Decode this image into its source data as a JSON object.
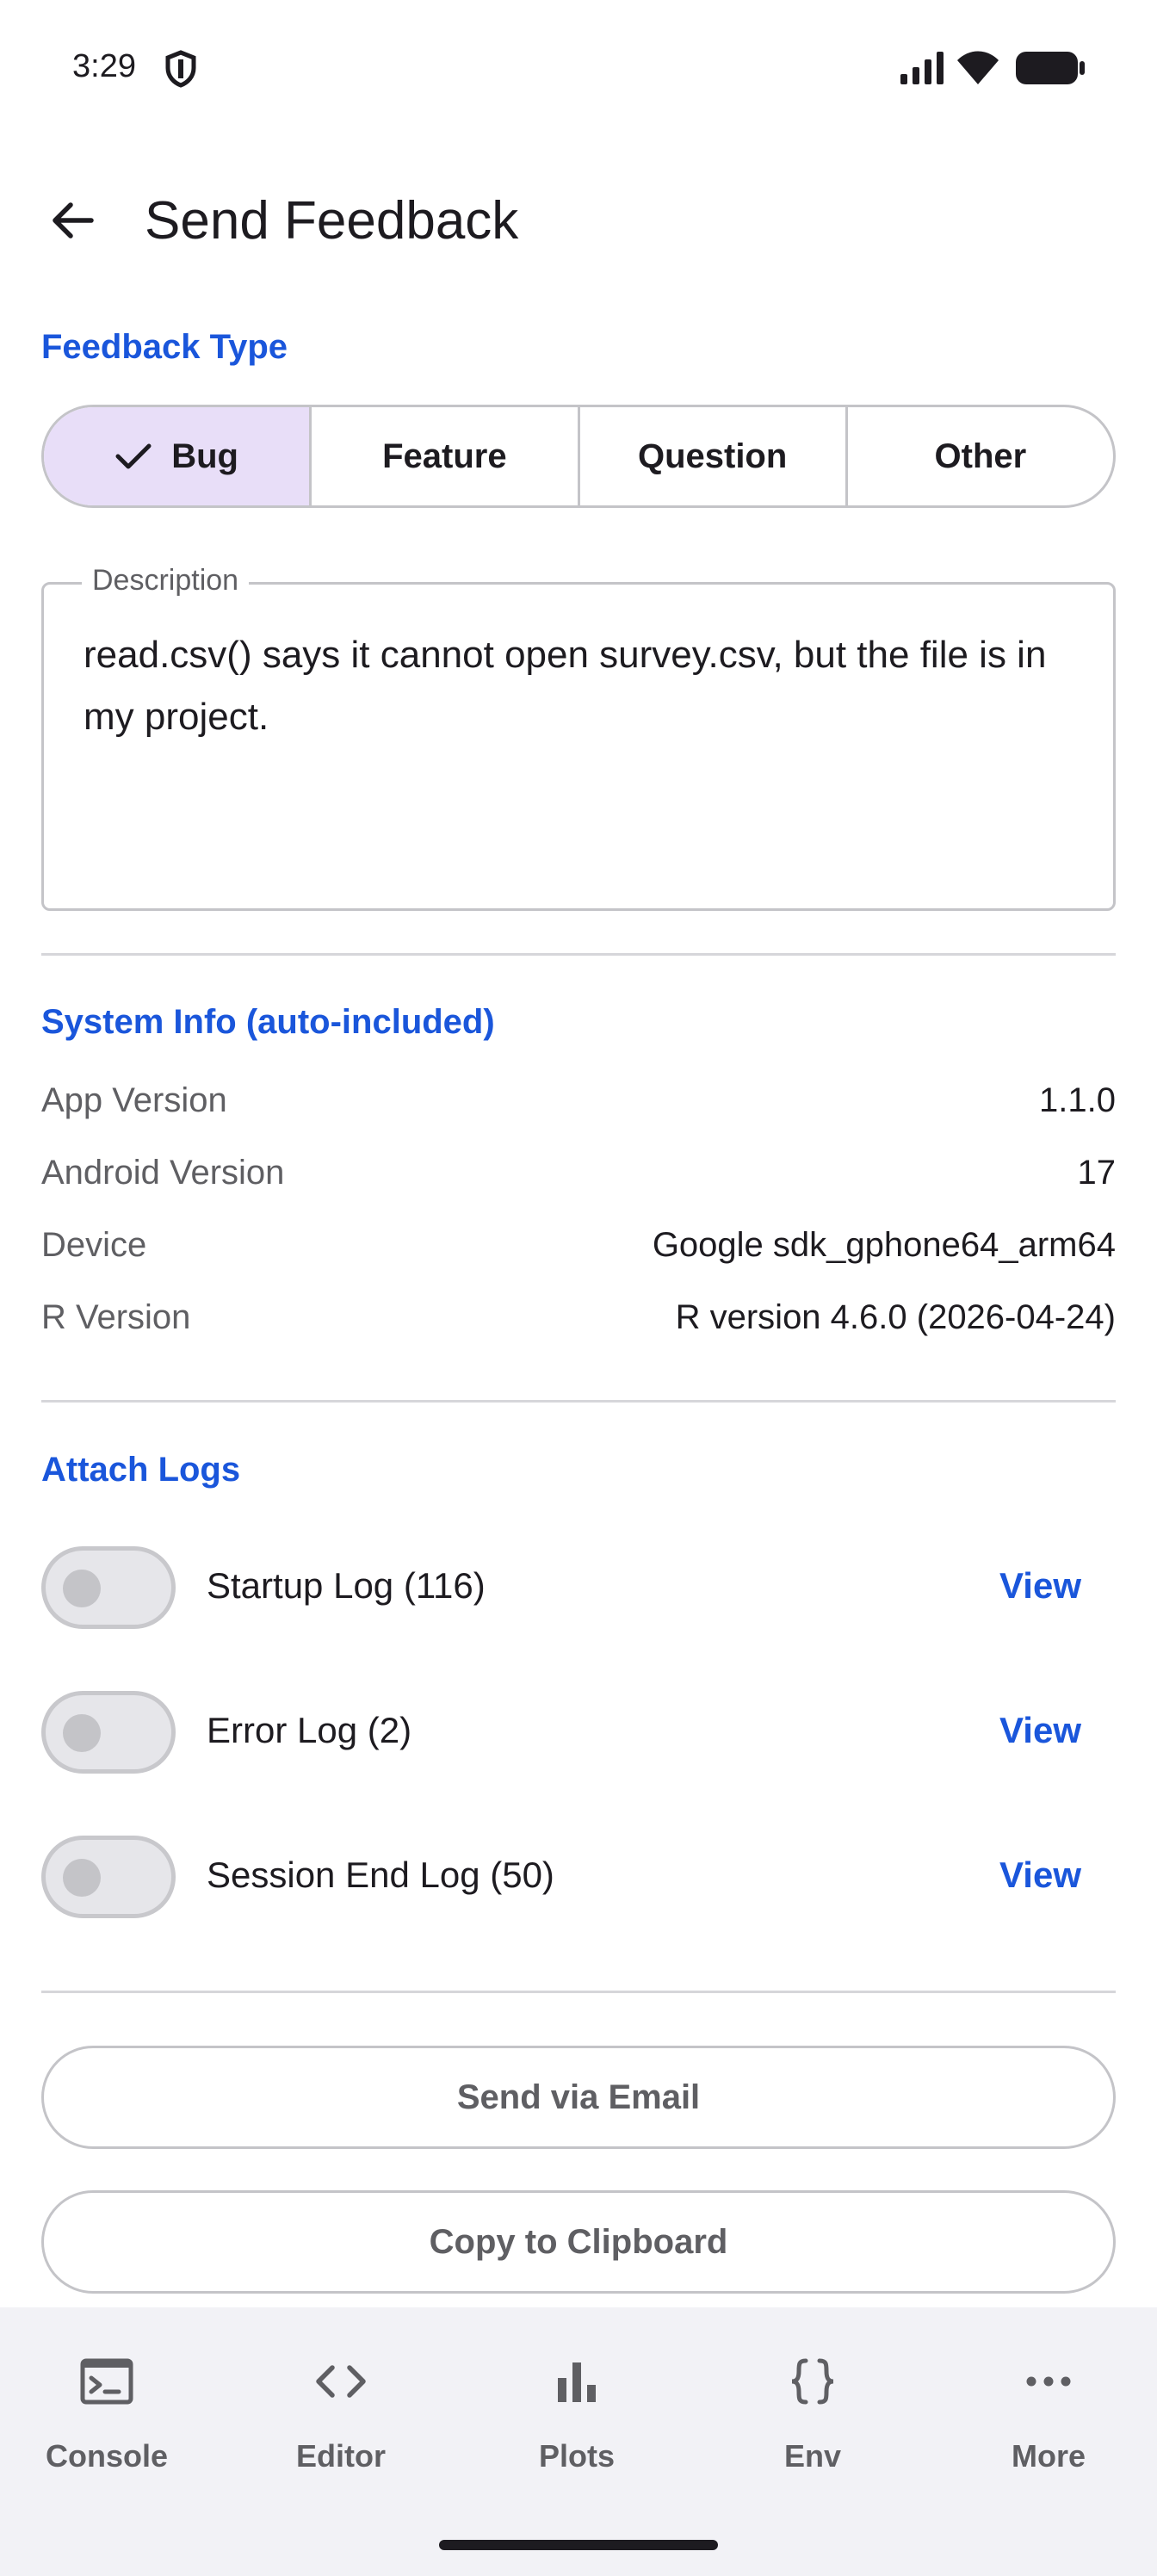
{
  "status": {
    "time": "3:29"
  },
  "header": {
    "title": "Send Feedback"
  },
  "feedback_type": {
    "label": "Feedback Type",
    "options": [
      "Bug",
      "Feature",
      "Question",
      "Other"
    ],
    "selected": "Bug"
  },
  "description": {
    "label": "Description",
    "value": "read.csv() says it cannot open survey.csv, but the file is in my project."
  },
  "system_info": {
    "label": "System Info (auto-included)",
    "rows": [
      {
        "key": "App Version",
        "value": "1.1.0"
      },
      {
        "key": "Android Version",
        "value": "17"
      },
      {
        "key": "Device",
        "value": "Google sdk_gphone64_arm64"
      },
      {
        "key": "R Version",
        "value": "R version 4.6.0 (2026-04-24)"
      }
    ]
  },
  "logs": {
    "label": "Attach Logs",
    "items": [
      {
        "name": "Startup Log (116)",
        "enabled": false,
        "action": "View"
      },
      {
        "name": "Error Log (2)",
        "enabled": false,
        "action": "View"
      },
      {
        "name": "Session End Log (50)",
        "enabled": false,
        "action": "View"
      }
    ]
  },
  "actions": {
    "email": "Send via Email",
    "clipboard": "Copy to Clipboard"
  },
  "nav": {
    "items": [
      {
        "label": "Console",
        "icon": "terminal-icon"
      },
      {
        "label": "Editor",
        "icon": "code-icon"
      },
      {
        "label": "Plots",
        "icon": "bar-chart-icon"
      },
      {
        "label": "Env",
        "icon": "braces-icon"
      },
      {
        "label": "More",
        "icon": "more-horizontal-icon"
      }
    ]
  },
  "colors": {
    "accent": "#1a56db",
    "selected_segment": "#e8def8",
    "nav_background": "#f2f2f6"
  }
}
